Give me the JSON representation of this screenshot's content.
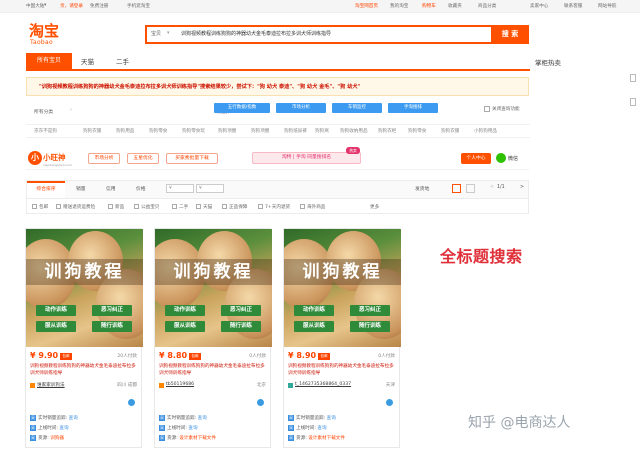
{
  "topbar": {
    "region": "中国大陆",
    "region_arrow": "▾",
    "greeting": "亲，请登录",
    "register": "免费注册",
    "mobile": "手机逛淘宝",
    "home": "淘宝网首页",
    "my_taobao": "我的淘宝",
    "cart": "购物车",
    "favorites": "收藏夹",
    "goods_category": "商品分类",
    "seller_center": "卖家中心",
    "contact": "联系客服",
    "sitemap": "网站导航"
  },
  "logo": {
    "cn": "淘宝",
    "en": "Taobao"
  },
  "search": {
    "scope": "宝贝",
    "scope_arrow": "▾",
    "query": "训狗视频教程训练狗狗的神器幼犬金毛泰迪拉布拉多训犬师训练指导",
    "button": "搜 索"
  },
  "tabs": {
    "all": "所有宝贝",
    "tmall": "天猫",
    "second": "二手"
  },
  "hot_sidebar": {
    "title": "掌柜热卖"
  },
  "notice": {
    "text": "\"训狗视频教程训练狗狗的神器幼犬金毛泰迪拉布拉多训犬师训练指导\"搜索结果较少，尝试下：\"狗 幼犬 泰迪\"、\"狗 幼犬 金毛\"、\"狗 幼犬\""
  },
  "filter_row1": {
    "label": "所有分类",
    "arrow": "›",
    "select_label": "请选择:",
    "buttons": [
      "五行数据/指数",
      "市场分析",
      "车销监控",
      "手淘搜排"
    ],
    "check_label": "关闭查询功能"
  },
  "filter_row2": {
    "items": [
      "京东不是狗",
      "狗狗衣服",
      "狗狗用品",
      "狗狗零食",
      "狗狗零食玩",
      "狗狗项圈",
      "狗狗项圈",
      "狗狗纸尿裤",
      "狗狗窝",
      "狗狗收纳用品",
      "狗狗衣柜",
      "狗狗零食",
      "狗狗衣服",
      "狗狗沐浴露",
      "小狗狗用品"
    ]
  },
  "plugin": {
    "logo_char": "小",
    "name": "小旺神",
    "sub": "xiaowangshen.com",
    "buttons": [
      "市场分析",
      "五星优化",
      "买家秀批量下载"
    ],
    "hot": "淘特 | 手淘 同量搜排名",
    "badge": "热卖",
    "user": "个人中心",
    "wechat": "微信"
  },
  "sortbar": {
    "default": "综合排序",
    "sales": "销量",
    "credit": "信用",
    "price": "价格",
    "price_from": "¥",
    "price_to": "¥",
    "ship_from": "发货地",
    "page": "1/1",
    "prev": "<",
    "next": ">"
  },
  "options": [
    "包邮",
    "赠送退货运费险",
    "新品",
    "公益宝贝",
    "二手",
    "天猫",
    "正品保障",
    "7+天内退货",
    "海外商品",
    "更多"
  ],
  "products": [
    {
      "image_title": "训狗教程",
      "tags": [
        "动作训练",
        "恶习纠正",
        "服从训练",
        "随行训练"
      ],
      "price": "¥ 9.90",
      "price_tag": "包邮",
      "paid": "20人付款",
      "title": "训狗视频教程训练狗狗的神器幼犬金毛泰迪拉布拉多训犬师训练指导",
      "shop": "谁家家训狗法",
      "location": "四川 成都",
      "line1_label": "采",
      "line1": "实时销量追踪:",
      "line1_link": "查询",
      "line2_label": "采",
      "line2": "上线时间:",
      "line2_link": "查询",
      "line3_label": "采",
      "line3": "货源:",
      "line3_val": "训狗器"
    },
    {
      "image_title": "训狗教程",
      "tags": [
        "动作训练",
        "恶习纠正",
        "服从训练",
        "随行训练"
      ],
      "price": "¥ 8.80",
      "price_tag": "包邮",
      "paid": "0人付款",
      "title": "训狗视频教程训练狗狗的神器幼犬金毛泰迪拉布拉多训犬师训练指导",
      "shop": "tb50119686",
      "location": "北京",
      "line1_label": "采",
      "line1": "实时销量追踪:",
      "line1_link": "查询",
      "line2_label": "采",
      "line2": "上线时间:",
      "line2_link": "查询",
      "line3_label": "采",
      "line3": "货源:",
      "line3_val": "设计素材下载文件"
    },
    {
      "image_title": "训狗教程",
      "tags": [
        "动作训练",
        "恶习纠正",
        "服从训练",
        "随行训练"
      ],
      "price": "¥ 8.90",
      "price_tag": "包邮",
      "paid": "0人付款",
      "title": "训狗视频教程训练狗狗的神器幼犬金毛泰迪拉布拉多训犬师训练指导",
      "shop": "t_1462735368864_0337",
      "location": "天津",
      "line1_label": "采",
      "line1": "实时销量追踪:",
      "line1_link": "查询",
      "line2_label": "采",
      "line2": "上线时间:",
      "line2_link": "查询",
      "line3_label": "采",
      "line3": "货源:",
      "line3_val": "设计素材下载文件"
    }
  ],
  "overlay": {
    "title": "全标题搜索",
    "watermark": "知乎 @电商达人"
  },
  "colors": {
    "brand": "#ff5000",
    "price": "#ff4400",
    "link": "#3a8ee0",
    "overlay": "#e0303a"
  }
}
